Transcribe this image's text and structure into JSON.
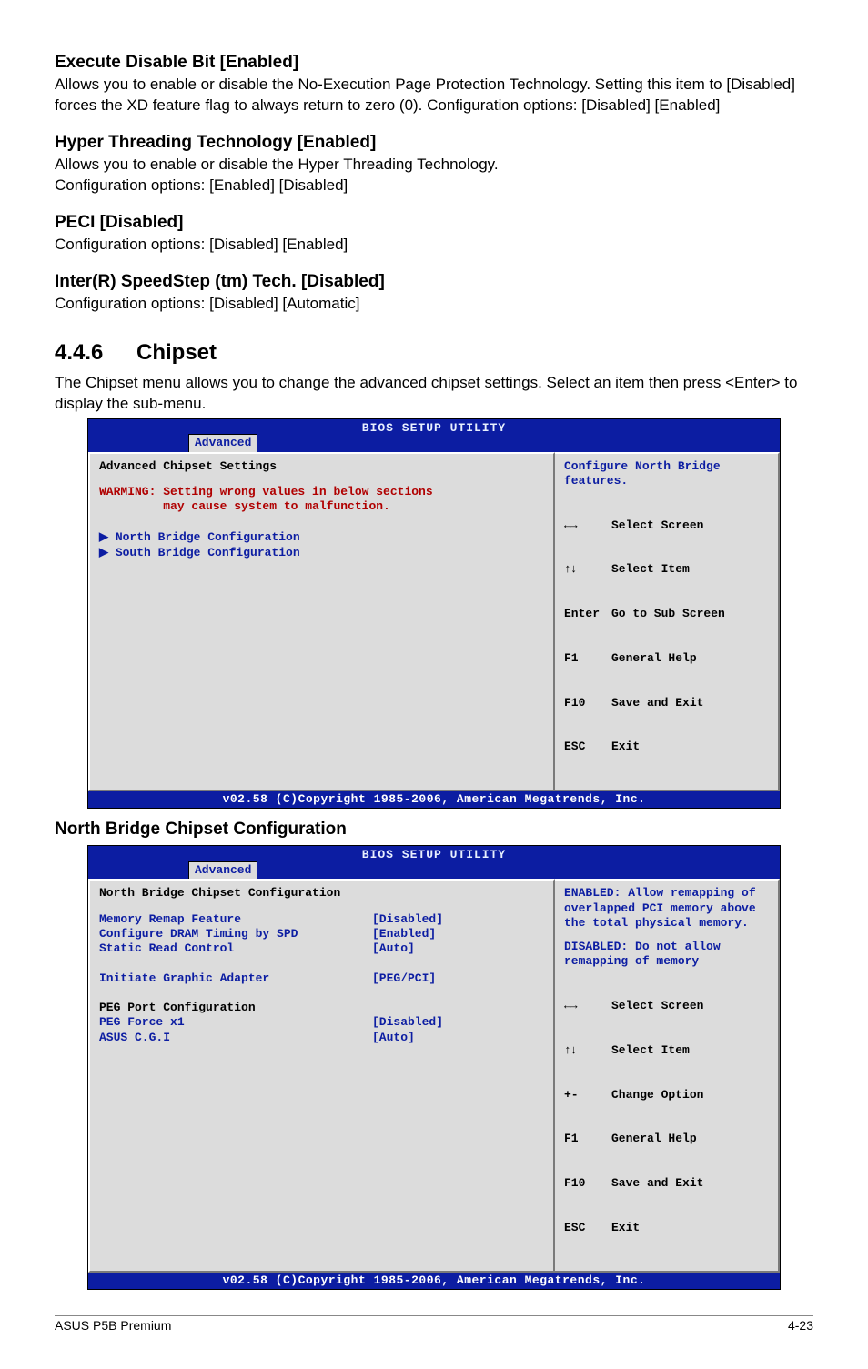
{
  "options": [
    {
      "heading": "Execute Disable Bit [Enabled]",
      "desc": "Allows you to enable or disable the No-Execution Page Protection Technology. Setting this item to [Disabled] forces the XD feature flag to always return to zero (0). Configuration options: [Disabled] [Enabled]"
    },
    {
      "heading": "Hyper Threading Technology [Enabled]",
      "desc": "Allows you to enable or disable the Hyper Threading Technology.\nConfiguration options: [Enabled] [Disabled]"
    },
    {
      "heading": "PECI [Disabled]",
      "desc": "Configuration options: [Disabled] [Enabled]"
    },
    {
      "heading": "Inter(R) SpeedStep (tm) Tech. [Disabled]",
      "desc": "Configuration options: [Disabled] [Automatic]"
    }
  ],
  "section": {
    "number": "4.4.6",
    "title": "Chipset",
    "desc": "The Chipset menu allows you to change the advanced chipset settings. Select an item then press <Enter> to display the sub-menu."
  },
  "bios1": {
    "title": "BIOS SETUP UTILITY",
    "tab": "Advanced",
    "header": "Advanced Chipset Settings",
    "warn1": "WARMING: Setting wrong values in below sections",
    "warn2": "         may cause system to malfunction.",
    "menu1": "North Bridge Configuration",
    "menu2": "South Bridge Configuration",
    "help": "Configure North Bridge features.",
    "nav": {
      "lr": "Select Screen",
      "ud": "Select Item",
      "enter_key": "Enter",
      "enter": "Go to Sub Screen",
      "f1_key": "F1",
      "f1": "General Help",
      "f10_key": "F10",
      "f10": "Save and Exit",
      "esc_key": "ESC",
      "esc": "Exit"
    },
    "copyright": "v02.58 (C)Copyright 1985-2006, American Megatrends, Inc."
  },
  "sub_heading": "North Bridge Chipset Configuration",
  "bios2": {
    "title": "BIOS SETUP UTILITY",
    "tab": "Advanced",
    "header": "North Bridge Chipset Configuration",
    "rows": [
      {
        "lbl": "Memory Remap Feature",
        "val": "[Disabled]",
        "blue": true
      },
      {
        "lbl": "Configure DRAM Timing by SPD",
        "val": "[Enabled]",
        "blue": true
      },
      {
        "lbl": "Static Read Control",
        "val": "[Auto]",
        "blue": true
      },
      {
        "lbl": "",
        "val": "",
        "blue": true
      },
      {
        "lbl": "Initiate Graphic Adapter",
        "val": "[PEG/PCI]",
        "blue": true
      },
      {
        "lbl": "",
        "val": "",
        "blue": true
      },
      {
        "lbl": "PEG Port Configuration",
        "val": "",
        "blue": false
      },
      {
        "lbl": "PEG Force x1",
        "val": "[Disabled]",
        "blue": true
      },
      {
        "lbl": "ASUS C.G.I",
        "val": "[Auto]",
        "blue": true
      }
    ],
    "help1": "ENABLED: Allow remapping of overlapped PCI memory above the total physical memory.",
    "help2": "DISABLED: Do not allow remapping of memory",
    "nav": {
      "lr": "Select Screen",
      "ud": "Select Item",
      "pm_key": "+-",
      "pm": "Change Option",
      "f1_key": "F1",
      "f1": "General Help",
      "f10_key": "F10",
      "f10": "Save and Exit",
      "esc_key": "ESC",
      "esc": "Exit"
    },
    "copyright": "v02.58 (C)Copyright 1985-2006, American Megatrends, Inc."
  },
  "footer": {
    "left": "ASUS P5B Premium",
    "right": "4-23"
  }
}
